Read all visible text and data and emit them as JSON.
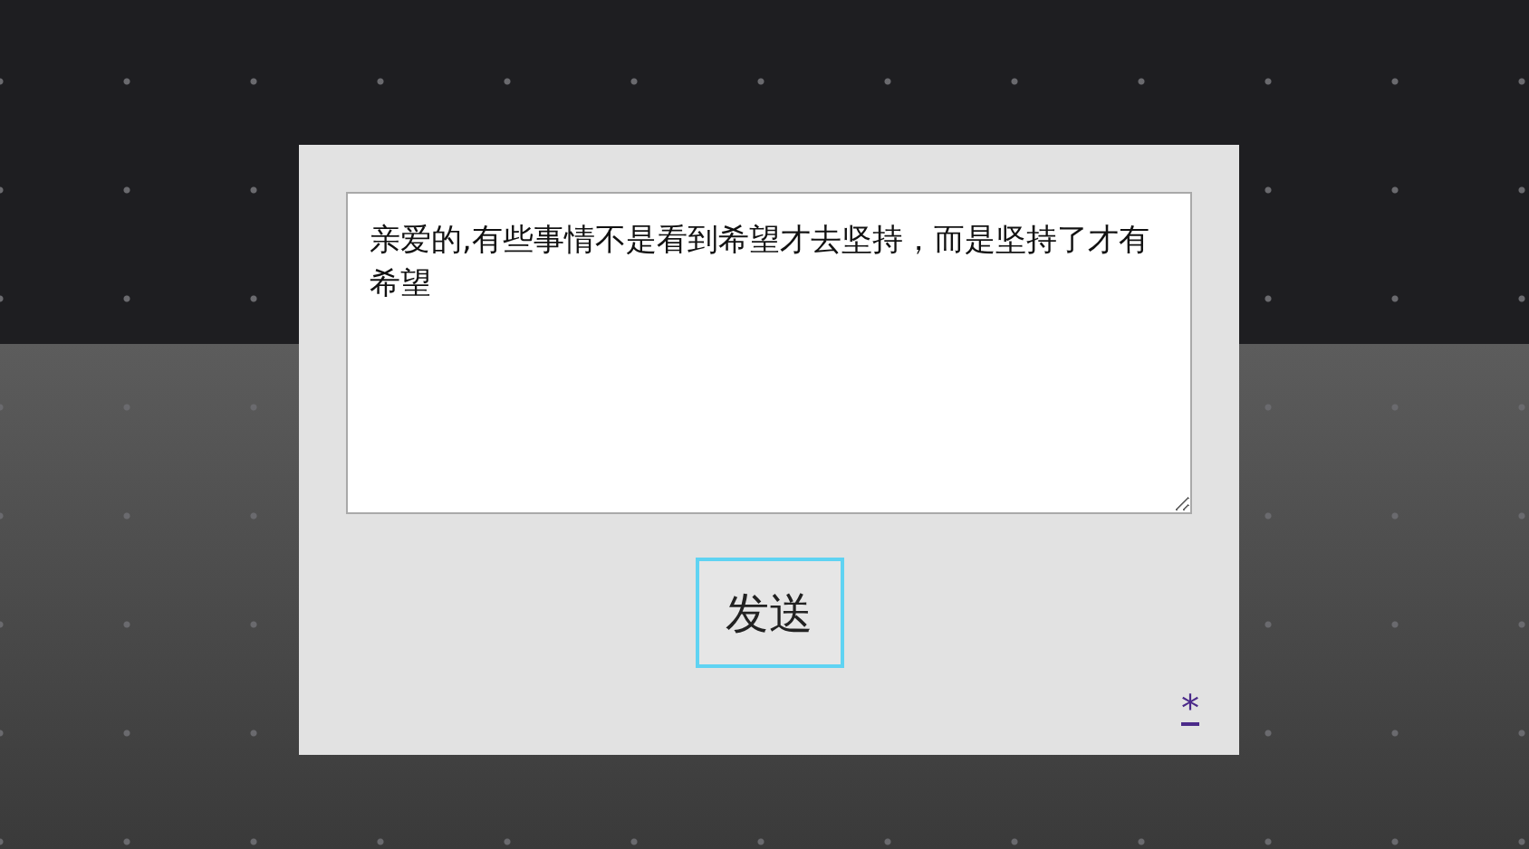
{
  "message": {
    "value": "亲爱的,有些事情不是看到希望才去坚持，而是坚持了才有希望"
  },
  "send_button": {
    "label": "发送"
  },
  "link": {
    "label": "*"
  }
}
